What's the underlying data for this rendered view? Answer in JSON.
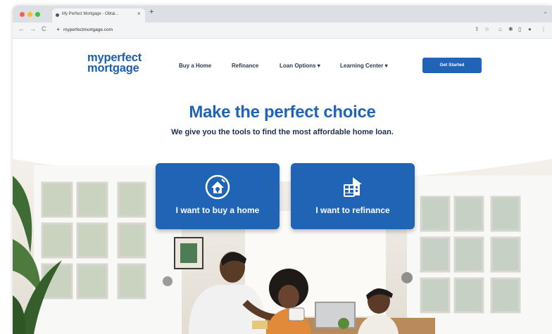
{
  "browser": {
    "tab_title": "My Perfect Mortgage - Obtai...",
    "tab_close": "×",
    "new_tab": "+",
    "url": "myperfectmortgage.com",
    "nav_back": "←",
    "nav_forward": "→",
    "nav_reload": "C"
  },
  "header": {
    "logo_line1": "myperfect",
    "logo_line2": "mortgage",
    "nav": {
      "buy": "Buy a Home",
      "refinance": "Refinance",
      "loan_options": "Loan Options ▾",
      "learning_center": "Learning Center ▾"
    },
    "cta": "Get Started"
  },
  "hero": {
    "title": "Make the perfect choice",
    "subtitle": "We give you the tools to find the most affordable home loan."
  },
  "cards": {
    "buy": "I want to buy a home",
    "refinance": "I want to refinance"
  },
  "colors": {
    "brand_blue": "#1f64b5",
    "text_dark": "#1c2f4f"
  }
}
